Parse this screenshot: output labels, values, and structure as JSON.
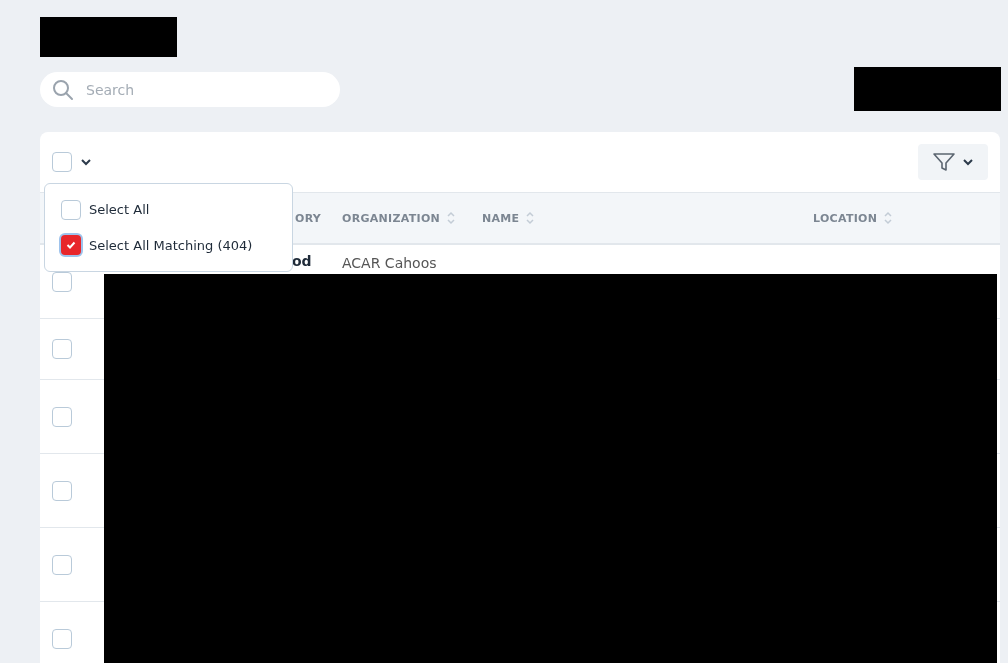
{
  "search": {
    "placeholder": "Search"
  },
  "toolbar": {
    "select_checkbox": {
      "checked": false
    },
    "select_menu": {
      "expanded": true,
      "options": [
        {
          "label": "Select All",
          "checked": false
        },
        {
          "label": "Select All Matching (404)",
          "checked": true
        }
      ]
    }
  },
  "table": {
    "columns": [
      "ORY",
      "ORGANIZATION",
      "NAME",
      "LOCATION"
    ],
    "rows": [
      {
        "checked": false,
        "cells": [
          "od",
          "ACAR Cahoos"
        ]
      },
      {
        "checked": false,
        "cells": []
      },
      {
        "checked": false,
        "cells": []
      },
      {
        "checked": false,
        "cells": []
      },
      {
        "checked": false,
        "cells": []
      },
      {
        "checked": false,
        "cells": []
      }
    ]
  }
}
